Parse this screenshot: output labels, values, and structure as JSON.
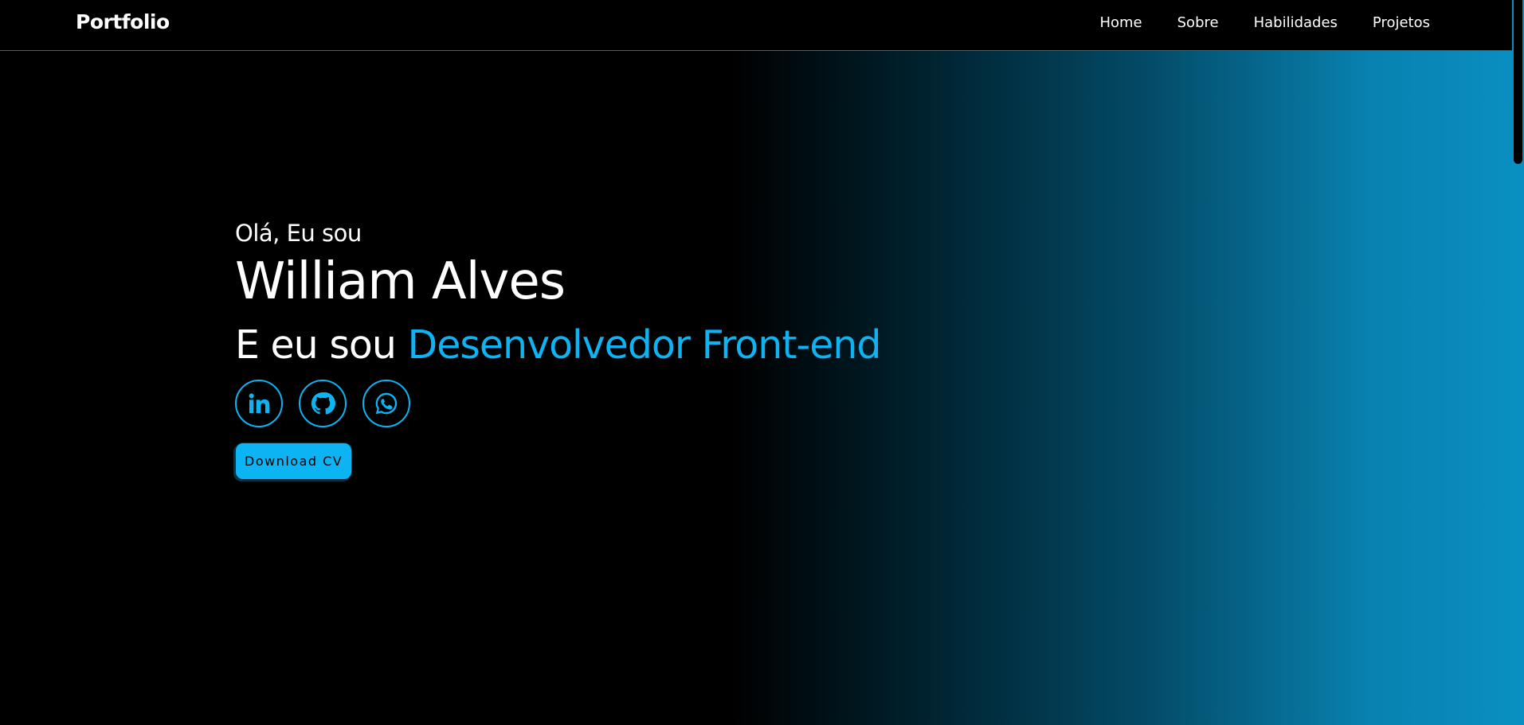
{
  "navbar": {
    "logo": "Portfolio",
    "links": [
      {
        "label": "Home"
      },
      {
        "label": "Sobre"
      },
      {
        "label": "Habilidades"
      },
      {
        "label": "Projetos"
      }
    ]
  },
  "hero": {
    "greeting": "Olá, Eu sou",
    "name": "William Alves",
    "role_prefix": "E eu sou",
    "role_highlight": "Desenvolvedor Front-end",
    "socials": [
      {
        "icon": "linkedin-icon"
      },
      {
        "icon": "github-icon"
      },
      {
        "icon": "whatsapp-icon"
      }
    ],
    "cv_button": "Download CV"
  },
  "colors": {
    "accent": "#0db4f3",
    "background": "#000000",
    "gradient_end": "#0a8fc2"
  }
}
